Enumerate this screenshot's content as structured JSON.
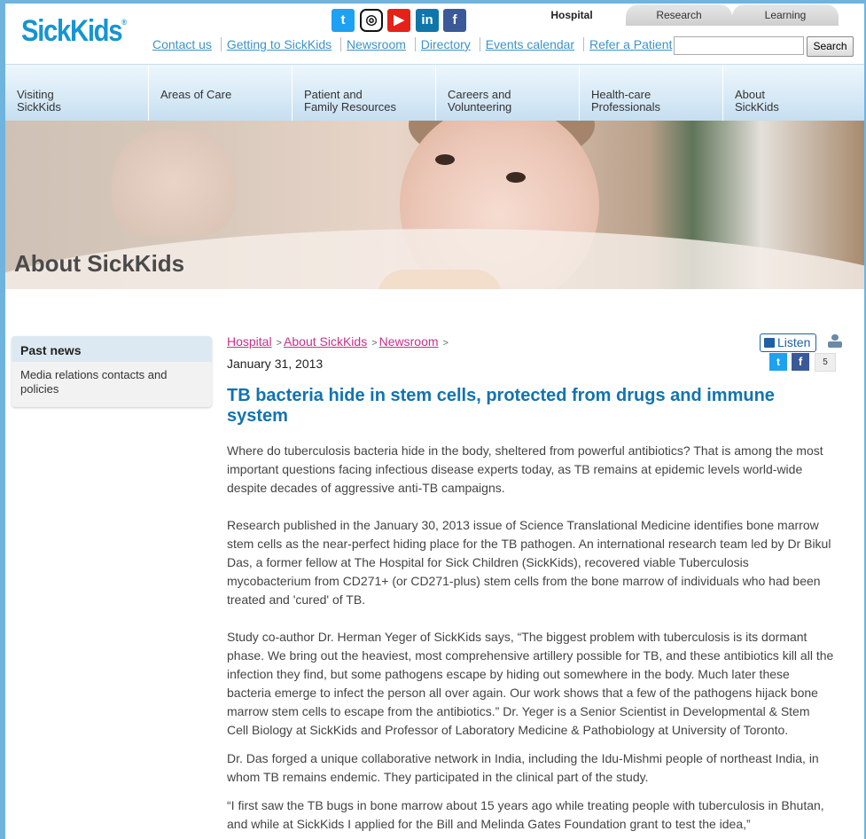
{
  "header": {
    "logo_text": "SickKids",
    "logo_mark": "®",
    "social": [
      {
        "name": "twitter",
        "glyph": "t"
      },
      {
        "name": "instagram",
        "glyph": "◎"
      },
      {
        "name": "youtube",
        "glyph": "▶"
      },
      {
        "name": "linkedin",
        "glyph": "in"
      },
      {
        "name": "facebook",
        "glyph": "f"
      }
    ],
    "top_tabs": [
      "Hospital",
      "Research",
      "Learning"
    ],
    "active_tab": "Hospital",
    "utility_links": [
      "Contact us",
      "Getting to SickKids",
      "Newsroom",
      "Directory",
      "Events calendar",
      "Refer a Patient"
    ],
    "search": {
      "value": "",
      "placeholder": "",
      "button_label": "Search"
    }
  },
  "main_nav": [
    {
      "line1": "Visiting",
      "line2": "SickKids"
    },
    {
      "line1": "Areas of Care",
      "line2": ""
    },
    {
      "line1": "Patient and",
      "line2": "Family Resources"
    },
    {
      "line1": "Careers and",
      "line2": "Volunteering"
    },
    {
      "line1": "Health-care",
      "line2": "Professionals"
    },
    {
      "line1": "About",
      "line2": "SickKids"
    }
  ],
  "hero": {
    "title": "About SickKids"
  },
  "sidebar": {
    "heading": "Past news",
    "link": "Media relations contacts and policies"
  },
  "breadcrumb": {
    "items": [
      "Hospital",
      "About SickKids",
      "Newsroom"
    ],
    "separator": ">"
  },
  "article": {
    "date": "January 31, 2013",
    "listen_label": "Listen",
    "share_count": "5",
    "share_twitter_glyph": "t",
    "share_facebook_glyph": "f",
    "headline": "TB bacteria hide in stem cells, protected from drugs and immune system",
    "paragraphs": [
      "Where do tuberculosis bacteria hide in the body, sheltered from powerful antibiotics? That is among the most important questions facing infectious disease experts today, as TB remains at epidemic levels world-wide despite decades of aggressive anti-TB campaigns.",
      "Research published in the January 30, 2013 issue of Science Translational Medicine identifies bone marrow stem cells as the near-perfect hiding place for the TB pathogen. An international research team led by Dr Bikul Das, a former fellow at The Hospital for Sick Children (SickKids), recovered viable Tuberculosis mycobacterium from CD271+ (or CD271-plus) stem cells from the bone marrow of individuals who had been treated and 'cured' of TB.",
      "Study co-author Dr. Herman Yeger of SickKids says, “The biggest problem with tuberculosis is its dormant phase. We bring out the heaviest, most comprehensive artillery possible for TB, and these antibiotics kill all the infection they find, but some pathogens escape by hiding out somewhere in the body. Much later these bacteria emerge to infect the person all over again. Our work shows that a few of the pathogens hijack bone marrow stem cells to escape from the antibiotics.” Dr. Yeger is a Senior Scientist in Developmental & Stem Cell Biology at SickKids and Professor of Laboratory Medicine & Pathobiology at University of Toronto.",
      "Dr. Das forged a unique collaborative network in India, including the Idu-Mishmi people of northeast India, in whom TB remains endemic. They participated in the clinical part of the study.",
      "“I first saw the TB bugs in bone marrow about 15 years ago while treating people with tuberculosis in Bhutan, and while at SickKids I applied for the Bill and Melinda Gates Foundation grant to test the idea,”"
    ]
  },
  "colors": {
    "brand_blue": "#1694d3",
    "link_blue": "#3d93c8",
    "headline_blue": "#1273b0",
    "breadcrumb_pink": "#c4328c",
    "frame_blue": "#6fb4de"
  }
}
